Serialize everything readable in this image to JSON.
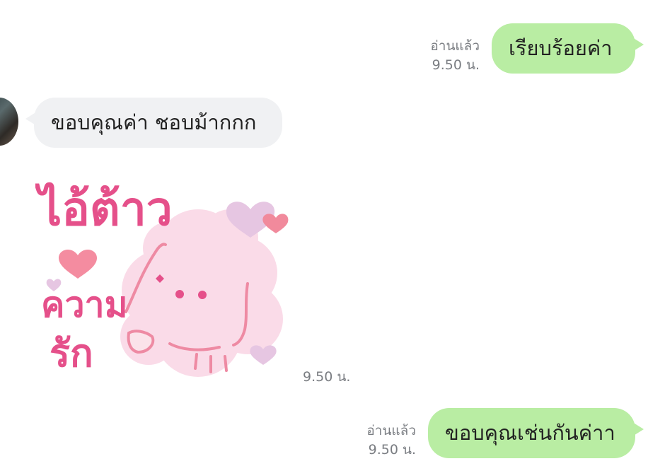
{
  "messages": [
    {
      "direction": "outgoing",
      "text": "เรียบร้อยค่า",
      "read_label": "อ่านแล้ว",
      "time": "9.50 น."
    },
    {
      "direction": "incoming",
      "text": "ขอบคุณค่า ชอบม้ากกก"
    },
    {
      "direction": "incoming",
      "type": "sticker",
      "sticker_lines": [
        "ไอ้ต้าว",
        "ความ",
        "รัก"
      ],
      "time": "9.50 น."
    },
    {
      "direction": "outgoing",
      "text": "ขอบคุณเช่นกันค่าา",
      "read_label": "อ่านแล้ว",
      "time": "9.50 น."
    }
  ],
  "colors": {
    "outgoing_bubble": "#b9eda3",
    "incoming_bubble": "#f0f1f3",
    "meta_text": "#7a7d82",
    "sticker_pink": "#e5508a"
  }
}
